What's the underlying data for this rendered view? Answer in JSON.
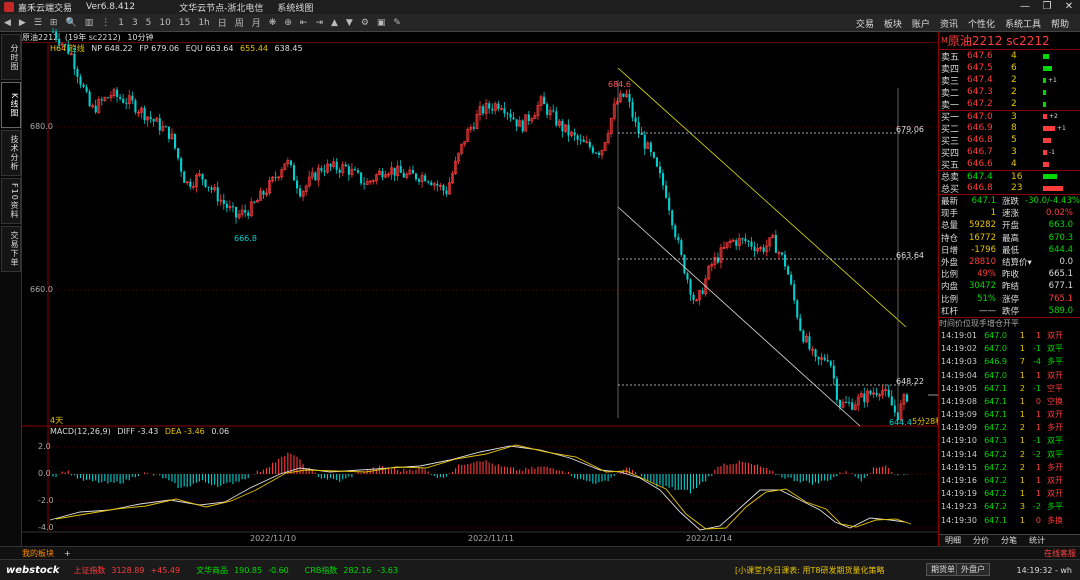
{
  "window": {
    "app_title": "嘉禾云端交易",
    "version": "Ver6.8.412",
    "center_title": "文华云节点-浙北电信",
    "sys_label": "系统线图",
    "controls": [
      "—",
      "❐",
      "✕"
    ]
  },
  "toolbar": {
    "left": [
      "◀",
      "▶",
      "☰",
      "⊞",
      "🔍",
      "▥",
      "⋮",
      "1",
      "3",
      "5",
      "10",
      "15",
      "1h",
      "日",
      "周",
      "月",
      "❋",
      "⊕",
      "⇤",
      "⇥",
      "▲",
      "▼",
      "⚙",
      "▣",
      "✎"
    ],
    "right": [
      "交易",
      "板块",
      "账户",
      "资讯",
      "个性化",
      "系统工具",
      "帮助"
    ]
  },
  "left_tabs": [
    {
      "label": "分时图",
      "active": false
    },
    {
      "label": "K线图",
      "active": true
    },
    {
      "label": "技术分析",
      "active": false
    },
    {
      "label": "F10资料",
      "active": false
    },
    {
      "label": "交易下单",
      "active": false
    }
  ],
  "chart_header": {
    "contract": "原油2212",
    "sub": "(19年 sc2212)",
    "period": "10分钟",
    "ind_name": "H64 趋线",
    "np": "NP 648.22",
    "fp": "FP 679.06",
    "equ": "EQU 663.64",
    "y1": "655.44",
    "y2": "638.45"
  },
  "price_labels": {
    "high": "684.6",
    "low_left": "666.8",
    "low_right": "644.4",
    "line1": "679.06",
    "line2": "663.64",
    "line3": "648.22",
    "last_tag": "5分28秒",
    "y680": "680.0",
    "y660": "660.0",
    "bottom_label": "4天"
  },
  "macd_header": {
    "name": "MACD(12,26,9)",
    "diff": "DIFF -3.43",
    "dea": "DEA -3.46",
    "macd": "0.06"
  },
  "macd_axis": [
    "2.0",
    "0.0",
    "-2.0",
    "-4.0"
  ],
  "x_axis": [
    "2022/11/10",
    "2022/11/11",
    "2022/11/14"
  ],
  "right_panel": {
    "title_mark": "M",
    "title": "原油2212  sc2212",
    "asks": [
      {
        "label": "卖五",
        "price": "647.6",
        "vol": "4",
        "bar": 0.3,
        "chg": ""
      },
      {
        "label": "卖四",
        "price": "647.5",
        "vol": "6",
        "bar": 0.45,
        "chg": ""
      },
      {
        "label": "卖三",
        "price": "647.4",
        "vol": "2",
        "bar": 0.15,
        "chg": "+1"
      },
      {
        "label": "卖二",
        "price": "647.3",
        "vol": "2",
        "bar": 0.15,
        "chg": ""
      },
      {
        "label": "卖一",
        "price": "647.2",
        "vol": "2",
        "bar": 0.15,
        "chg": ""
      }
    ],
    "bids": [
      {
        "label": "买一",
        "price": "647.0",
        "vol": "3",
        "bar": 0.2,
        "chg": "+2"
      },
      {
        "label": "买二",
        "price": "646.9",
        "vol": "8",
        "bar": 0.6,
        "chg": "+1"
      },
      {
        "label": "买三",
        "price": "646.8",
        "vol": "5",
        "bar": 0.38,
        "chg": ""
      },
      {
        "label": "买四",
        "price": "646.7",
        "vol": "3",
        "bar": 0.22,
        "chg": "-1"
      },
      {
        "label": "买五",
        "price": "646.6",
        "vol": "4",
        "bar": 0.3,
        "chg": ""
      }
    ],
    "totals": [
      {
        "label": "总卖",
        "price": "647.4",
        "vol": "16",
        "bar": 0.7,
        "color": "#00d900"
      },
      {
        "label": "总买",
        "price": "646.8",
        "vol": "23",
        "bar": 1.0,
        "color": "#ff3b3b"
      }
    ],
    "quote": [
      {
        "l1": "最新",
        "v1": "647.1",
        "c1": "green",
        "l2": "涨跌",
        "v2": "-30.0/-4.43%",
        "c2": "green"
      },
      {
        "l1": "现手",
        "v1": "1",
        "c1": "yel",
        "l2": "速涨",
        "v2": "0.02%",
        "c2": "red"
      },
      {
        "l1": "总量",
        "v1": "59282",
        "c1": "yel",
        "l2": "开盘",
        "v2": "663.0",
        "c2": "green"
      },
      {
        "l1": "持仓",
        "v1": "16772",
        "c1": "yel",
        "l2": "最高",
        "v2": "670.3",
        "c2": "green"
      },
      {
        "l1": "日增",
        "v1": "-1796",
        "c1": "yel",
        "l2": "最低",
        "v2": "644.4",
        "c2": "green"
      },
      {
        "l1": "外盘",
        "v1": "28810",
        "c1": "red",
        "l2": "结算价▾",
        "v2": "0.0",
        "c2": "wht"
      },
      {
        "l1": "比例",
        "v1": "49%",
        "c1": "red",
        "l2": "昨收",
        "v2": "665.1",
        "c2": "wht"
      },
      {
        "l1": "内盘",
        "v1": "30472",
        "c1": "green",
        "l2": "昨结",
        "v2": "677.1",
        "c2": "wht"
      },
      {
        "l1": "比例",
        "v1": "51%",
        "c1": "green",
        "l2": "涨停",
        "v2": "765.1",
        "c2": "red"
      },
      {
        "l1": "杠杆",
        "v1": "——",
        "c1": "wht",
        "l2": "跌停",
        "v2": "589.0",
        "c2": "green"
      }
    ],
    "tick_headers": [
      "时间",
      "价位",
      "现手",
      "增仓",
      "开平"
    ],
    "ticks": [
      {
        "t": "14:19:01",
        "p": "647.0",
        "pc": "green",
        "v": "1",
        "c": "1",
        "n": "双开",
        "nc": "red"
      },
      {
        "t": "14:19:02",
        "p": "647.0",
        "pc": "green",
        "v": "1",
        "c": "-1",
        "n": "双平",
        "nc": "green"
      },
      {
        "t": "14:19:03",
        "p": "646.9",
        "pc": "green",
        "v": "7",
        "c": "-4",
        "n": "多平",
        "nc": "green"
      },
      {
        "t": "14:19:04",
        "p": "647.0",
        "pc": "green",
        "v": "1",
        "c": "1",
        "n": "双开",
        "nc": "red"
      },
      {
        "t": "14:19:05",
        "p": "647.1",
        "pc": "green",
        "v": "2",
        "c": "-1",
        "n": "空平",
        "nc": "red"
      },
      {
        "t": "14:19:08",
        "p": "647.1",
        "pc": "green",
        "v": "1",
        "c": "0",
        "n": "空换",
        "nc": "red"
      },
      {
        "t": "14:19:09",
        "p": "647.1",
        "pc": "green",
        "v": "1",
        "c": "1",
        "n": "双开",
        "nc": "red"
      },
      {
        "t": "14:19:09",
        "p": "647.2",
        "pc": "green",
        "v": "2",
        "c": "1",
        "n": "多开",
        "nc": "red"
      },
      {
        "t": "14:19:10",
        "p": "647.3",
        "pc": "green",
        "v": "1",
        "c": "-1",
        "n": "双平",
        "nc": "green"
      },
      {
        "t": "14:19:14",
        "p": "647.2",
        "pc": "green",
        "v": "2",
        "c": "-2",
        "n": "双平",
        "nc": "green"
      },
      {
        "t": "14:19:15",
        "p": "647.2",
        "pc": "green",
        "v": "2",
        "c": "1",
        "n": "多开",
        "nc": "red"
      },
      {
        "t": "14:19:16",
        "p": "647.2",
        "pc": "green",
        "v": "1",
        "c": "1",
        "n": "双开",
        "nc": "red"
      },
      {
        "t": "14:19:19",
        "p": "647.2",
        "pc": "green",
        "v": "1",
        "c": "1",
        "n": "双开",
        "nc": "red"
      },
      {
        "t": "14:19:23",
        "p": "647.2",
        "pc": "green",
        "v": "3",
        "c": "-2",
        "n": "多平",
        "nc": "green"
      },
      {
        "t": "14:19:30",
        "p": "647.1",
        "pc": "green",
        "v": "1",
        "c": "0",
        "n": "多换",
        "nc": "red"
      }
    ],
    "bottom_tabs": [
      "明细",
      "分价",
      "分笔",
      "统计"
    ]
  },
  "bottom_tabs": {
    "my": "我的板块",
    "plus": "+",
    "online": "在线客服"
  },
  "status": {
    "brand": "webstock",
    "indices": [
      {
        "name": "上证指数",
        "value": "3128.89",
        "chg": "+45.49",
        "color": "red"
      },
      {
        "name": "文华商品",
        "value": "190.85",
        "chg": "-0.60",
        "color": "green"
      },
      {
        "name": "CRB指数",
        "value": "282.16",
        "chg": "-3.63",
        "color": "green"
      }
    ],
    "news": "[小课堂]今日课表: 用T8研发期货量化策略",
    "btn1": "期货单",
    "btn2": "外盘户",
    "clock": "14:19:32 - wh"
  },
  "colors": {
    "up": "#ff3b3b",
    "down": "#00d0d0",
    "border": "#8b0000",
    "channel": "#e6e600",
    "yellow": "#e6c300"
  }
}
